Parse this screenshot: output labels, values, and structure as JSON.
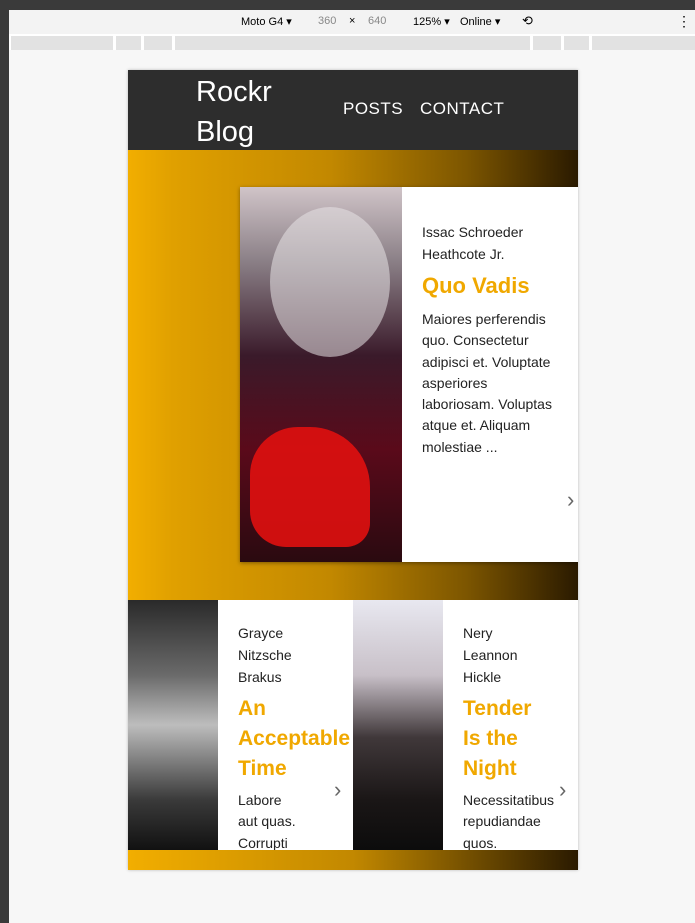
{
  "devtools": {
    "device": "Moto G4",
    "width": "360",
    "times": "×",
    "height": "640",
    "zoom": "125%",
    "network": "Online"
  },
  "blog": {
    "logo_line1": "Rockr",
    "logo_line2": "Blog",
    "nav": [
      "POSTS",
      "CONTACT"
    ]
  },
  "hero": {
    "author_line1": "Issac Schroeder",
    "author_line2": "Heathcote Jr.",
    "title": "Quo Vadis",
    "excerpt": "Maiores perferendis quo. Consectetur adipisci et. Voluptate asperiores laboriosam. Voluptas atque et. Aliquam molestiae ..."
  },
  "cards": [
    {
      "author": [
        "Grayce",
        "Nitzsche",
        "Brakus"
      ],
      "title": [
        "An",
        "Acceptable",
        "Time"
      ],
      "excerpt": [
        "Labore",
        "aut quas.",
        "Corrupti"
      ]
    },
    {
      "author": [
        "Nery",
        "Leannon",
        "Hickle"
      ],
      "title": [
        "Tender",
        "Is the",
        "Night"
      ],
      "excerpt": [
        "Necessitatibus",
        "repudiandae",
        "quos."
      ]
    }
  ],
  "icons": {
    "chevron": "chevron-right-icon",
    "rotate": "rotate-icon",
    "menu": "more-vert-icon"
  }
}
